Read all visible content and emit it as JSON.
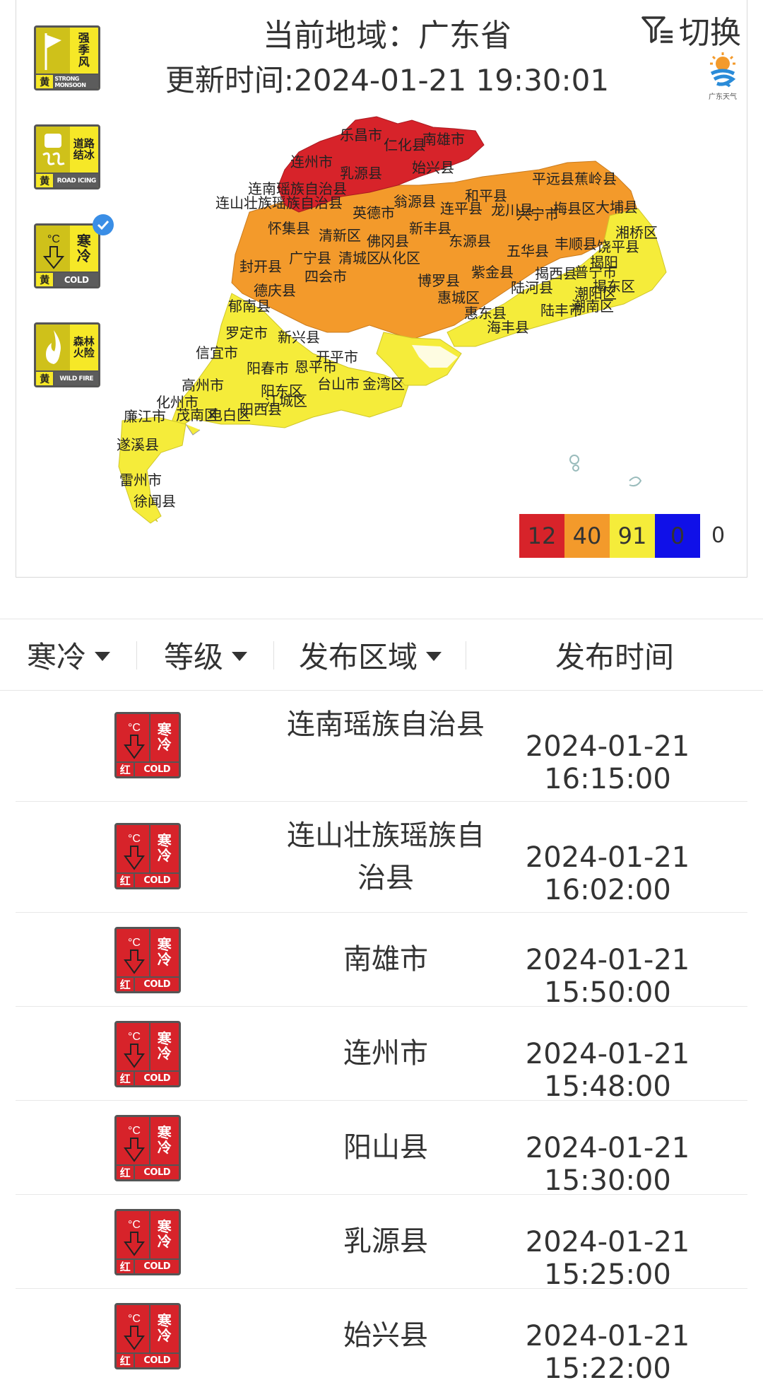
{
  "header": {
    "region_label": "当前地域：广东省",
    "update_time": "更新时间:2024-01-21 19:30:01",
    "switch_label": "切换",
    "logo_text": "广东天气"
  },
  "side_icons": [
    {
      "name": "strong-monsoon",
      "cn": [
        "强",
        "季",
        "风"
      ],
      "level": "黄",
      "en": "STRONG MONSOON",
      "color": "#f6e827",
      "selected": false
    },
    {
      "name": "road-icing",
      "cn": [
        "道路",
        "结冰"
      ],
      "level": "黄",
      "en": "ROAD ICING",
      "color": "#f6e827",
      "selected": false
    },
    {
      "name": "cold",
      "cn": [
        "寒",
        "冷"
      ],
      "level": "黄",
      "en": "COLD",
      "color": "#f6e827",
      "selected": true
    },
    {
      "name": "wild-fire",
      "cn": [
        "森林",
        "火险"
      ],
      "level": "黄",
      "en": "WILD FIRE",
      "color": "#f6e827",
      "selected": false
    }
  ],
  "legend": {
    "red": {
      "count": "12",
      "color": "#d7232a"
    },
    "orange": {
      "count": "40",
      "color": "#f39a2b"
    },
    "yellow": {
      "count": "91",
      "color": "#f5ec3a"
    },
    "blue": {
      "count": "0",
      "color": "#1010e8"
    },
    "extra": "0"
  },
  "map_labels": {
    "red": [
      "乐昌市",
      "仁化县",
      "南雄市",
      "连州市",
      "始兴县",
      "乳源县",
      "连南瑶族自治县",
      "连山壮族瑶族自治县"
    ],
    "orange": [
      "平远县",
      "蕉岭县",
      "和平县",
      "翁源县",
      "连平县",
      "龙川县",
      "兴宁市",
      "梅县区",
      "大埔县",
      "英德市",
      "新丰县",
      "怀集县",
      "清新区",
      "佛冈县",
      "东源县",
      "广宁县",
      "清城区",
      "从化区",
      "五华县",
      "丰顺县",
      "饶平县",
      "封开县",
      "四会市",
      "紫金县",
      "揭西县",
      "德庆县",
      "郁南县",
      "博罗县",
      "惠城区",
      "陆河县",
      "潮阳区",
      "罗定市",
      "新兴县",
      "惠东县",
      "陆丰市",
      "海丰县",
      "普宁市",
      "潮南区"
    ],
    "yellow": [
      "信宜市",
      "阳春市",
      "恩平市",
      "开平市",
      "台山市",
      "金湾区",
      "高州市",
      "阳东区",
      "化州市",
      "茂南区",
      "电白区",
      "阳西县",
      "江城区",
      "廉江市",
      "遂溪县",
      "雷州市",
      "徐闻县",
      "揭阳",
      "揭东区",
      "湘桥区"
    ]
  },
  "filters": {
    "type": "寒冷",
    "level": "等级",
    "region": "发布区域",
    "time_header": "发布时间"
  },
  "badge": {
    "cn": [
      "寒",
      "冷"
    ],
    "level": "红",
    "en": "COLD"
  },
  "warnings": [
    {
      "area": "连南瑶族自治县",
      "time": "2024-01-21 16:15:00"
    },
    {
      "area": "连山壮族瑶族自治县",
      "time": "2024-01-21 16:02:00"
    },
    {
      "area": "南雄市",
      "time": "2024-01-21 15:50:00"
    },
    {
      "area": "连州市",
      "time": "2024-01-21 15:48:00"
    },
    {
      "area": "阳山县",
      "time": "2024-01-21 15:30:00"
    },
    {
      "area": "乳源县",
      "time": "2024-01-21 15:25:00"
    },
    {
      "area": "始兴县",
      "time": "2024-01-21 15:22:00"
    }
  ]
}
